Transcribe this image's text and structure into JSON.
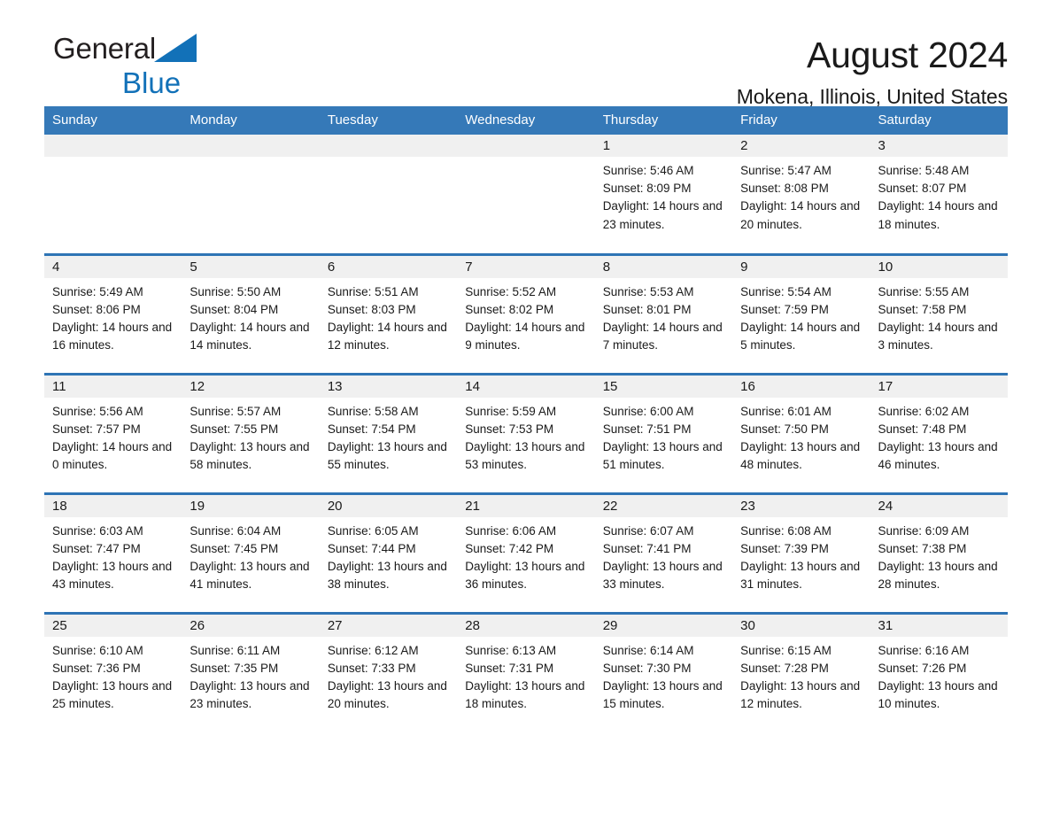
{
  "brand": {
    "name_part1": "General",
    "name_part2": "Blue",
    "triangle_icon": "triangle-icon",
    "color_dark": "#231f20",
    "color_blue": "#1271b8"
  },
  "header": {
    "title": "August 2024",
    "subtitle": "Mokena, Illinois, United States"
  },
  "colors": {
    "header_bar": "#3579b8",
    "row_divider": "#2e74b5",
    "daynum_band": "#f0f0f0",
    "text": "#1a1a1a"
  },
  "weekday_headers": [
    "Sunday",
    "Monday",
    "Tuesday",
    "Wednesday",
    "Thursday",
    "Friday",
    "Saturday"
  ],
  "labels": {
    "sunrise_prefix": "Sunrise:",
    "sunset_prefix": "Sunset:",
    "daylight_prefix": "Daylight:"
  },
  "weeks": [
    [
      {
        "day": "",
        "empty": true
      },
      {
        "day": "",
        "empty": true
      },
      {
        "day": "",
        "empty": true
      },
      {
        "day": "",
        "empty": true
      },
      {
        "day": "1",
        "sunrise": "Sunrise: 5:46 AM",
        "sunset": "Sunset: 8:09 PM",
        "daylight": "Daylight: 14 hours and 23 minutes."
      },
      {
        "day": "2",
        "sunrise": "Sunrise: 5:47 AM",
        "sunset": "Sunset: 8:08 PM",
        "daylight": "Daylight: 14 hours and 20 minutes."
      },
      {
        "day": "3",
        "sunrise": "Sunrise: 5:48 AM",
        "sunset": "Sunset: 8:07 PM",
        "daylight": "Daylight: 14 hours and 18 minutes."
      }
    ],
    [
      {
        "day": "4",
        "sunrise": "Sunrise: 5:49 AM",
        "sunset": "Sunset: 8:06 PM",
        "daylight": "Daylight: 14 hours and 16 minutes."
      },
      {
        "day": "5",
        "sunrise": "Sunrise: 5:50 AM",
        "sunset": "Sunset: 8:04 PM",
        "daylight": "Daylight: 14 hours and 14 minutes."
      },
      {
        "day": "6",
        "sunrise": "Sunrise: 5:51 AM",
        "sunset": "Sunset: 8:03 PM",
        "daylight": "Daylight: 14 hours and 12 minutes."
      },
      {
        "day": "7",
        "sunrise": "Sunrise: 5:52 AM",
        "sunset": "Sunset: 8:02 PM",
        "daylight": "Daylight: 14 hours and 9 minutes."
      },
      {
        "day": "8",
        "sunrise": "Sunrise: 5:53 AM",
        "sunset": "Sunset: 8:01 PM",
        "daylight": "Daylight: 14 hours and 7 minutes."
      },
      {
        "day": "9",
        "sunrise": "Sunrise: 5:54 AM",
        "sunset": "Sunset: 7:59 PM",
        "daylight": "Daylight: 14 hours and 5 minutes."
      },
      {
        "day": "10",
        "sunrise": "Sunrise: 5:55 AM",
        "sunset": "Sunset: 7:58 PM",
        "daylight": "Daylight: 14 hours and 3 minutes."
      }
    ],
    [
      {
        "day": "11",
        "sunrise": "Sunrise: 5:56 AM",
        "sunset": "Sunset: 7:57 PM",
        "daylight": "Daylight: 14 hours and 0 minutes."
      },
      {
        "day": "12",
        "sunrise": "Sunrise: 5:57 AM",
        "sunset": "Sunset: 7:55 PM",
        "daylight": "Daylight: 13 hours and 58 minutes."
      },
      {
        "day": "13",
        "sunrise": "Sunrise: 5:58 AM",
        "sunset": "Sunset: 7:54 PM",
        "daylight": "Daylight: 13 hours and 55 minutes."
      },
      {
        "day": "14",
        "sunrise": "Sunrise: 5:59 AM",
        "sunset": "Sunset: 7:53 PM",
        "daylight": "Daylight: 13 hours and 53 minutes."
      },
      {
        "day": "15",
        "sunrise": "Sunrise: 6:00 AM",
        "sunset": "Sunset: 7:51 PM",
        "daylight": "Daylight: 13 hours and 51 minutes."
      },
      {
        "day": "16",
        "sunrise": "Sunrise: 6:01 AM",
        "sunset": "Sunset: 7:50 PM",
        "daylight": "Daylight: 13 hours and 48 minutes."
      },
      {
        "day": "17",
        "sunrise": "Sunrise: 6:02 AM",
        "sunset": "Sunset: 7:48 PM",
        "daylight": "Daylight: 13 hours and 46 minutes."
      }
    ],
    [
      {
        "day": "18",
        "sunrise": "Sunrise: 6:03 AM",
        "sunset": "Sunset: 7:47 PM",
        "daylight": "Daylight: 13 hours and 43 minutes."
      },
      {
        "day": "19",
        "sunrise": "Sunrise: 6:04 AM",
        "sunset": "Sunset: 7:45 PM",
        "daylight": "Daylight: 13 hours and 41 minutes."
      },
      {
        "day": "20",
        "sunrise": "Sunrise: 6:05 AM",
        "sunset": "Sunset: 7:44 PM",
        "daylight": "Daylight: 13 hours and 38 minutes."
      },
      {
        "day": "21",
        "sunrise": "Sunrise: 6:06 AM",
        "sunset": "Sunset: 7:42 PM",
        "daylight": "Daylight: 13 hours and 36 minutes."
      },
      {
        "day": "22",
        "sunrise": "Sunrise: 6:07 AM",
        "sunset": "Sunset: 7:41 PM",
        "daylight": "Daylight: 13 hours and 33 minutes."
      },
      {
        "day": "23",
        "sunrise": "Sunrise: 6:08 AM",
        "sunset": "Sunset: 7:39 PM",
        "daylight": "Daylight: 13 hours and 31 minutes."
      },
      {
        "day": "24",
        "sunrise": "Sunrise: 6:09 AM",
        "sunset": "Sunset: 7:38 PM",
        "daylight": "Daylight: 13 hours and 28 minutes."
      }
    ],
    [
      {
        "day": "25",
        "sunrise": "Sunrise: 6:10 AM",
        "sunset": "Sunset: 7:36 PM",
        "daylight": "Daylight: 13 hours and 25 minutes."
      },
      {
        "day": "26",
        "sunrise": "Sunrise: 6:11 AM",
        "sunset": "Sunset: 7:35 PM",
        "daylight": "Daylight: 13 hours and 23 minutes."
      },
      {
        "day": "27",
        "sunrise": "Sunrise: 6:12 AM",
        "sunset": "Sunset: 7:33 PM",
        "daylight": "Daylight: 13 hours and 20 minutes."
      },
      {
        "day": "28",
        "sunrise": "Sunrise: 6:13 AM",
        "sunset": "Sunset: 7:31 PM",
        "daylight": "Daylight: 13 hours and 18 minutes."
      },
      {
        "day": "29",
        "sunrise": "Sunrise: 6:14 AM",
        "sunset": "Sunset: 7:30 PM",
        "daylight": "Daylight: 13 hours and 15 minutes."
      },
      {
        "day": "30",
        "sunrise": "Sunrise: 6:15 AM",
        "sunset": "Sunset: 7:28 PM",
        "daylight": "Daylight: 13 hours and 12 minutes."
      },
      {
        "day": "31",
        "sunrise": "Sunrise: 6:16 AM",
        "sunset": "Sunset: 7:26 PM",
        "daylight": "Daylight: 13 hours and 10 minutes."
      }
    ]
  ]
}
